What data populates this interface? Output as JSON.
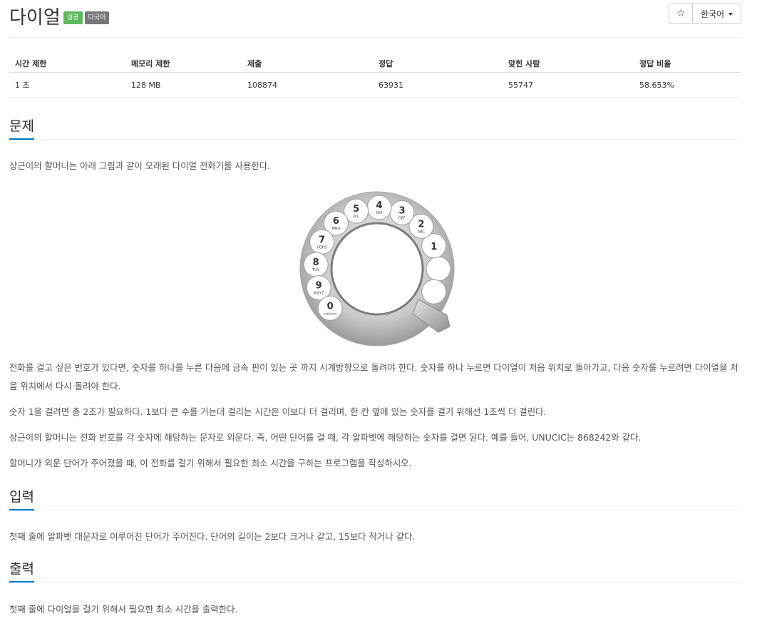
{
  "header": {
    "title": "다이얼",
    "badges": [
      "성공",
      "다국어"
    ],
    "star_icon": "☆",
    "language": "한국어"
  },
  "info_table": {
    "headers": [
      "시간 제한",
      "메모리 제한",
      "제출",
      "정답",
      "맞힌 사람",
      "정답 비율"
    ],
    "values": [
      "1 초",
      "128 MB",
      "108874",
      "63931",
      "55747",
      "58.653%"
    ]
  },
  "problem": {
    "heading": "문제",
    "intro": "상근이의 할머니는 아래 그림과 같이 오래된 다이얼 전화기를 사용한다.",
    "paragraphs": [
      "전화를 걸고 싶은 번호가 있다면, 숫자를 하나를 누른 다음에 금속 핀이 있는 곳 까지 시계방향으로 돌려야 한다. 숫자를 하나 누르면 다이얼이 처음 위치로 돌아가고, 다음 숫자를 누르려면 다이얼을 처음 위치에서 다시 돌려야 한다.",
      "숫자 1을 걸려면 총 2초가 필요하다. 1보다 큰 수를 거는데 걸리는 시간은 이보다 더 걸리며, 한 칸 옆에 있는 숫자를 걸기 위해선 1초씩 더 걸린다.",
      "상근이의 할머니는 전화 번호를 각 숫자에 해당하는 문자로 외운다. 즉, 어떤 단어를 걸 때, 각 알파벳에 해당하는 숫자를 걸면 된다. 예를 들어, UNUCIC는 868242와 같다.",
      "할머니가 외운 단어가 주어졌을 때, 이 전화를 걸기 위해서 필요한 최소 시간을 구하는 프로그램을 작성하시오."
    ]
  },
  "dial": {
    "keys": [
      {
        "digit": "1",
        "letters": ""
      },
      {
        "digit": "2",
        "letters": "ABC"
      },
      {
        "digit": "3",
        "letters": "DEF"
      },
      {
        "digit": "4",
        "letters": "GHI"
      },
      {
        "digit": "5",
        "letters": "JKL"
      },
      {
        "digit": "6",
        "letters": "MNO"
      },
      {
        "digit": "7",
        "letters": "PQRS"
      },
      {
        "digit": "8",
        "letters": "TUV"
      },
      {
        "digit": "9",
        "letters": "WXYZ"
      },
      {
        "digit": "0",
        "letters": "OPERATOR"
      }
    ]
  },
  "input": {
    "heading": "입력",
    "text": "첫째 줄에 알파벳 대문자로 이루어진 단어가 주어진다. 단어의 길이는 2보다 크거나 같고, 15보다 작거나 같다."
  },
  "output": {
    "heading": "출력",
    "text": "첫째 줄에 다이얼을 걸기 위해서 필요한 최소 시간을 출력한다."
  }
}
